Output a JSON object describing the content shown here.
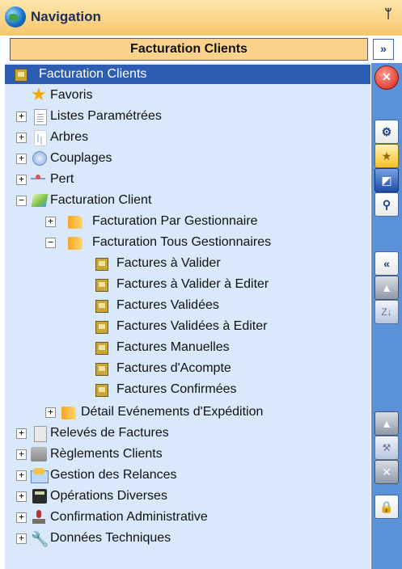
{
  "window": {
    "title": "Navigation",
    "pin_glyph": "ᛘ",
    "globe_icon": "globe-icon"
  },
  "header": {
    "title": "Facturation Clients",
    "expand_glyph": "»"
  },
  "tree": {
    "items": [
      {
        "label": "Facturation Clients",
        "icon": "gold-box-icon",
        "expander": "",
        "selected": true
      },
      {
        "label": "Favoris",
        "icon": "star-icon",
        "expander": ""
      },
      {
        "label": "Listes Paramétrées",
        "icon": "document-icon",
        "expander": "+"
      },
      {
        "label": "Arbres",
        "icon": "tree-icon",
        "expander": "+"
      },
      {
        "label": "Couplages",
        "icon": "couplage-icon",
        "expander": "+"
      },
      {
        "label": "Pert",
        "icon": "pert-icon",
        "expander": "+"
      },
      {
        "label": "Facturation Client",
        "icon": "cube-icon",
        "expander": "−"
      },
      {
        "label": "Facturation Par Gestionnaire",
        "icon": "folder-icon",
        "expander": "+"
      },
      {
        "label": "Facturation Tous Gestionnaires",
        "icon": "folder-icon",
        "expander": "−"
      },
      {
        "label": "Factures à Valider",
        "icon": "gold-box-icon",
        "expander": ""
      },
      {
        "label": "Factures à Valider à Editer",
        "icon": "gold-box-icon",
        "expander": ""
      },
      {
        "label": "Factures Validées",
        "icon": "gold-box-icon",
        "expander": ""
      },
      {
        "label": "Factures Validées à Editer",
        "icon": "gold-box-icon",
        "expander": ""
      },
      {
        "label": "Factures Manuelles",
        "icon": "gold-box-icon",
        "expander": ""
      },
      {
        "label": "Factures d'Acompte",
        "icon": "gold-box-icon",
        "expander": ""
      },
      {
        "label": "Factures Confirmées",
        "icon": "gold-box-icon",
        "expander": ""
      },
      {
        "label": "Détail Evénements d'Expédition",
        "icon": "folder-icon",
        "expander": "+"
      },
      {
        "label": "Relevés de Factures",
        "icon": "grey-document-icon",
        "expander": "+"
      },
      {
        "label": "Règlements Clients",
        "icon": "boxes-icon",
        "expander": "+"
      },
      {
        "label": "Gestion des Relances",
        "icon": "envelope-icon",
        "expander": "+"
      },
      {
        "label": "Opérations Diverses",
        "icon": "calculator-icon",
        "expander": "+"
      },
      {
        "label": "Confirmation Administrative",
        "icon": "stamp-icon",
        "expander": "+"
      },
      {
        "label": "Données Techniques",
        "icon": "wrench-icon",
        "expander": "+"
      }
    ]
  },
  "toolbar": {
    "close_glyph": "✕",
    "wheel_glyph": "⚙",
    "star_glyph": "★",
    "window_glyph": "◩",
    "search_glyph": "⚲",
    "collapse_glyph": "«",
    "up_glyph": "▲",
    "sort_glyph": "Z↓",
    "up2_glyph": "▲",
    "tool_glyph": "⚒",
    "delete_glyph": "✕",
    "lock_glyph": "🔒"
  },
  "colors": {
    "title_gradient_top": "#fde6ad",
    "title_gradient_bottom": "#f7c66c",
    "header_bg": "#fbd28d",
    "tree_bg": "#d9e8fb",
    "toolbar_bg": "#5b92d7",
    "selection": "#2d5db2"
  }
}
